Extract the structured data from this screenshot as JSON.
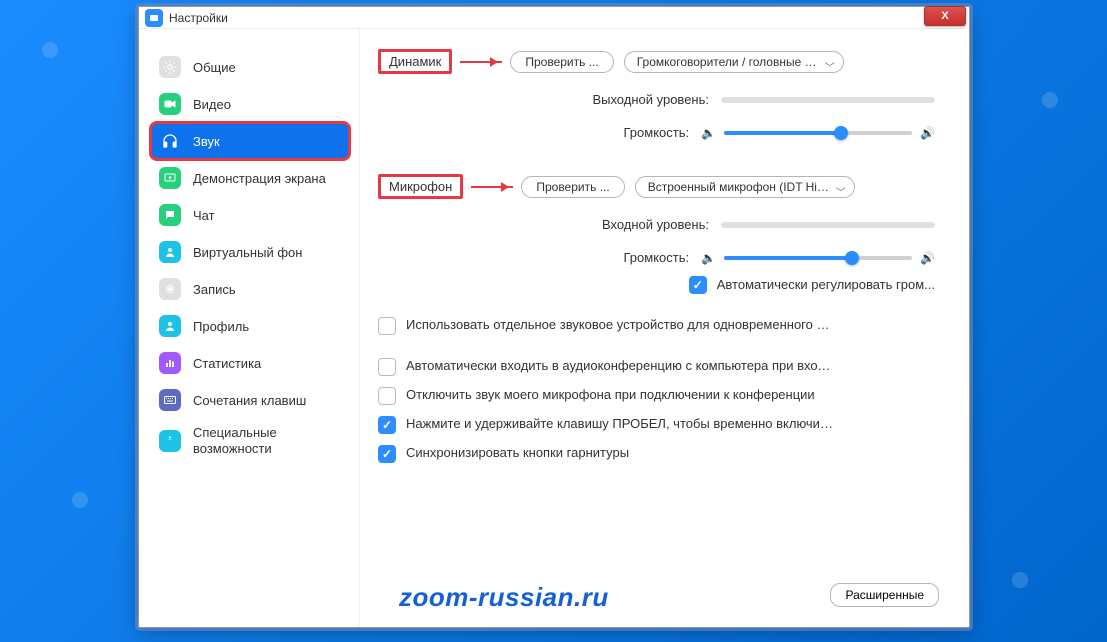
{
  "window": {
    "title": "Настройки",
    "close_x": "X"
  },
  "sidebar": {
    "items": [
      {
        "label": "Общие",
        "icon": "gear",
        "color": "#e0e0e0"
      },
      {
        "label": "Видео",
        "icon": "video",
        "color": "#26d07c"
      },
      {
        "label": "Звук",
        "icon": "headphones",
        "color": "#fff",
        "active": true
      },
      {
        "label": "Демонстрация экрана",
        "icon": "share",
        "color": "#26d07c"
      },
      {
        "label": "Чат",
        "icon": "chat",
        "color": "#26d07c"
      },
      {
        "label": "Виртуальный фон",
        "icon": "person",
        "color": "#1ec1e8"
      },
      {
        "label": "Запись",
        "icon": "record",
        "color": "#e0e0e0"
      },
      {
        "label": "Профиль",
        "icon": "profile",
        "color": "#1ec1e8"
      },
      {
        "label": "Статистика",
        "icon": "stats",
        "color": "#a259ff"
      },
      {
        "label": "Сочетания клавиш",
        "icon": "keyboard",
        "color": "#5c6bc0"
      },
      {
        "label": "Специальные возможности",
        "icon": "accessibility",
        "color": "#1ec1e8"
      }
    ]
  },
  "audio": {
    "speaker": {
      "label": "Динамик",
      "test": "Проверить ...",
      "device": "Громкоговорители / головные т..."
    },
    "output_level_label": "Выходной уровень:",
    "mic": {
      "label": "Микрофон",
      "test": "Проверить ...",
      "device": "Встроенный микрофон (IDT Hig..."
    },
    "input_level_label": "Входной уровень:",
    "volume_label": "Громкость:",
    "speaker_volume_pct": 62,
    "mic_volume_pct": 68,
    "auto_adjust": "Автоматически регулировать гром...",
    "options": [
      {
        "checked": false,
        "label": "Использовать отдельное звуковое устройство для одновременного воспро..."
      },
      {
        "checked": false,
        "label": "Автоматически входить в аудиоконференцию с компьютера при входе в кон..."
      },
      {
        "checked": false,
        "label": "Отключить звук моего микрофона при подключении к конференции"
      },
      {
        "checked": true,
        "label": "Нажмите и удерживайте клавишу ПРОБЕЛ, чтобы временно включить свой з..."
      },
      {
        "checked": true,
        "label": "Синхронизировать кнопки гарнитуры"
      }
    ],
    "advanced": "Расширенные"
  },
  "watermark": "zoom-russian.ru"
}
